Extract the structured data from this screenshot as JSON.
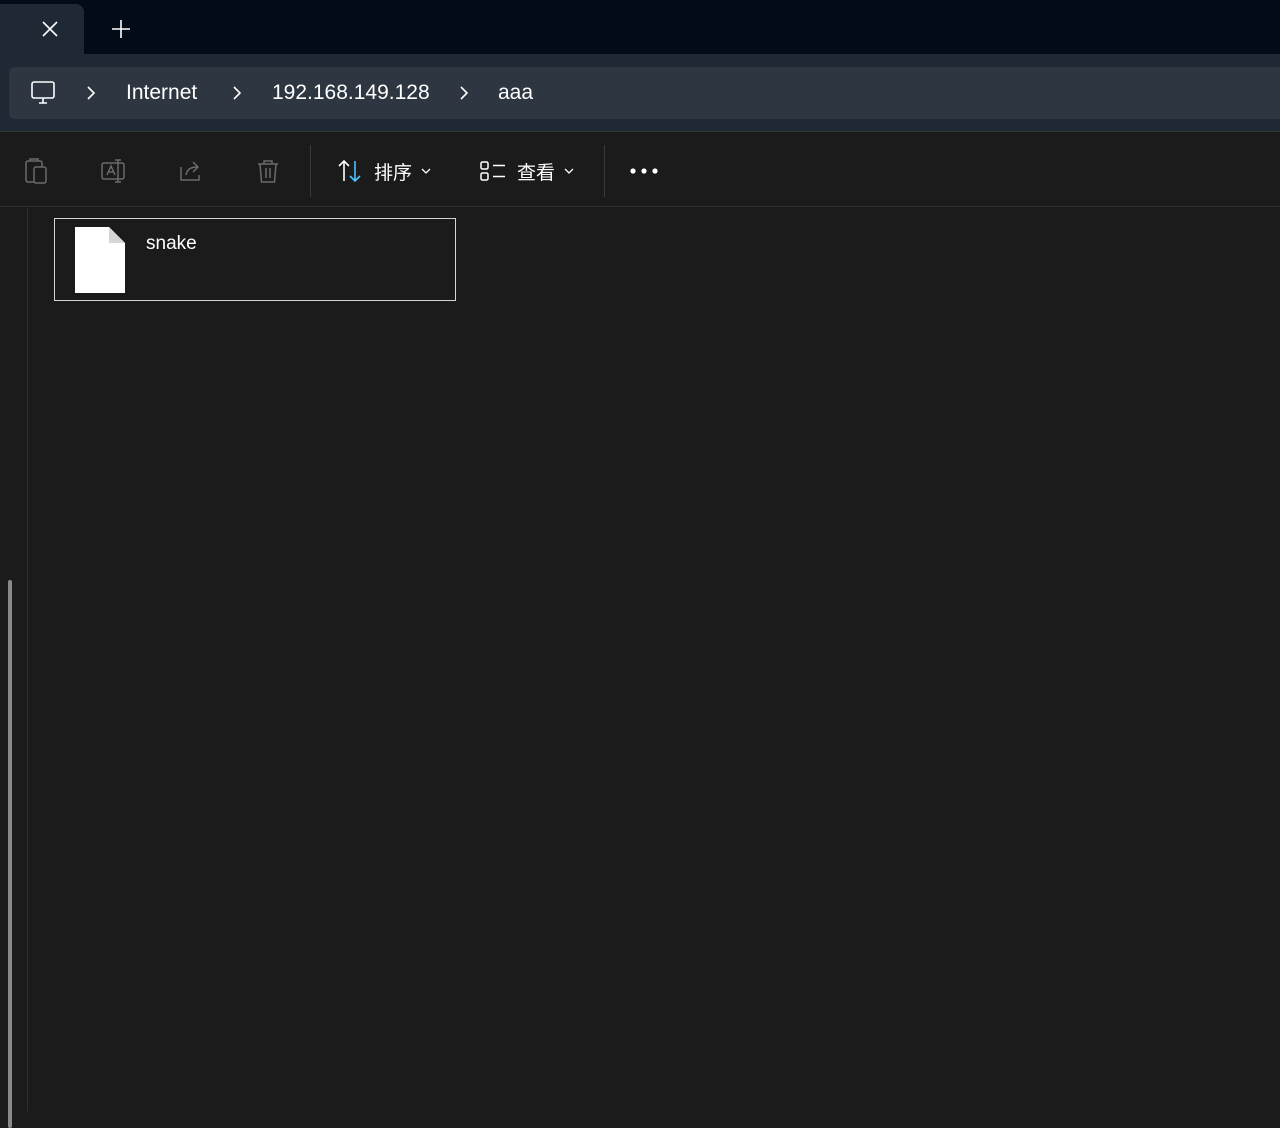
{
  "titlebar": {
    "tab_close_icon": "close-icon",
    "new_tab_icon": "plus-icon"
  },
  "address": {
    "root_icon": "computer-icon",
    "crumbs": [
      "Internet",
      "192.168.149.128",
      "aaa"
    ]
  },
  "toolbar": {
    "icons": [
      "paste-icon",
      "rename-icon",
      "share-icon",
      "delete-icon"
    ],
    "sort_label": "排序",
    "view_label": "查看",
    "more_icon": "more-icon",
    "accent": "#4cc2ff"
  },
  "files": [
    {
      "name": "snake",
      "icon": "file-icon"
    }
  ]
}
